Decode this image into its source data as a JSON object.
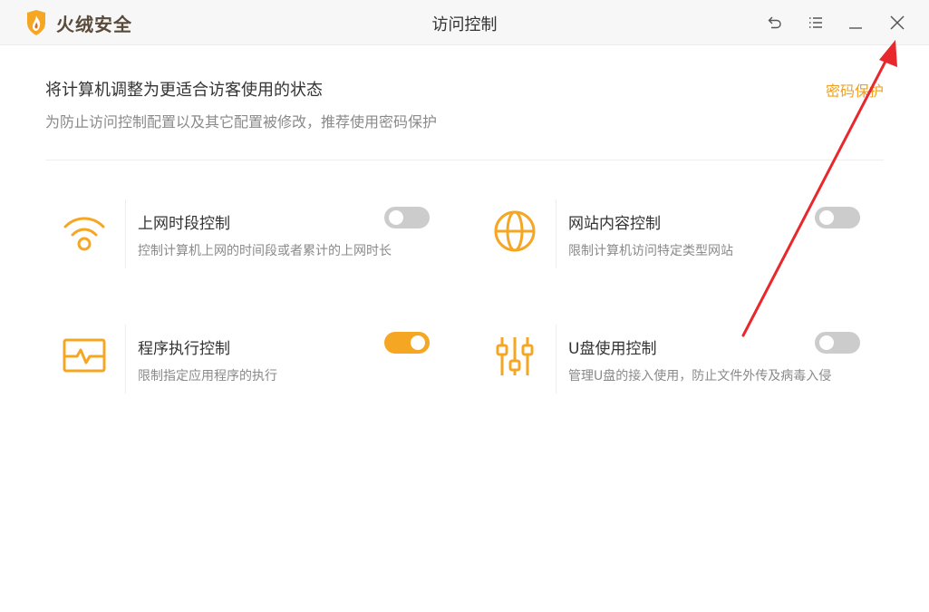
{
  "app": {
    "name": "火绒安全",
    "window_title": "访问控制"
  },
  "header": {
    "title": "将计算机调整为更适合访客使用的状态",
    "subtitle": "为防止访问控制配置以及其它配置被修改，推荐使用密码保护",
    "password_link": "密码保护"
  },
  "features": [
    {
      "title": "上网时段控制",
      "desc": "控制计算机上网的时间段或者累计的上网时长",
      "icon": "wifi-icon",
      "enabled": false
    },
    {
      "title": "网站内容控制",
      "desc": "限制计算机访问特定类型网站",
      "icon": "globe-icon",
      "enabled": false
    },
    {
      "title": "程序执行控制",
      "desc": "限制指定应用程序的执行",
      "icon": "monitor-pulse-icon",
      "enabled": true
    },
    {
      "title": "U盘使用控制",
      "desc": "管理U盘的接入使用，防止文件外传及病毒入侵",
      "icon": "sliders-icon",
      "enabled": false
    }
  ],
  "colors": {
    "accent": "#f5a623",
    "link": "#f0a020",
    "toggle_off": "#cccccc",
    "annotation_arrow": "#e8282c"
  }
}
